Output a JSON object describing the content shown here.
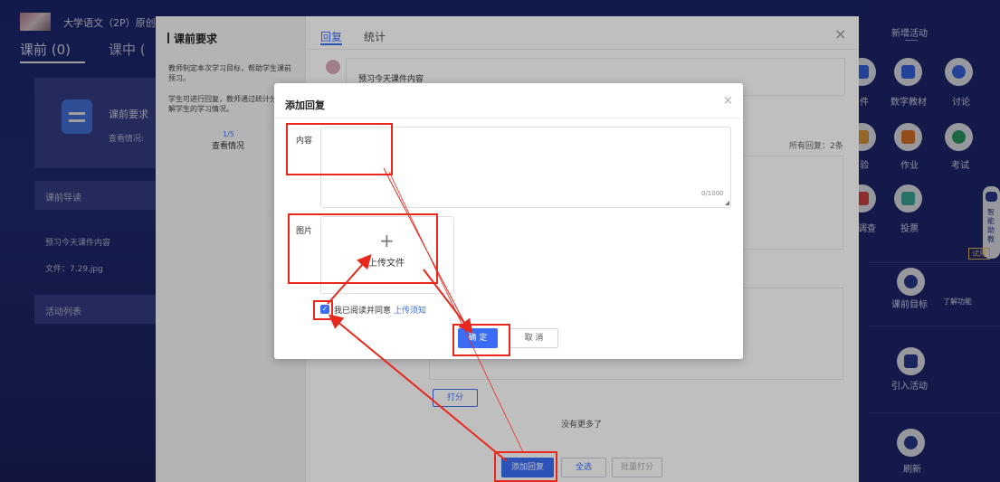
{
  "course": {
    "title": "大学语文（2P）原创",
    "tabs": [
      "课前 (0)",
      "课中 ("
    ],
    "card_title": "课前要求",
    "card_sub": "查看情况:",
    "section_guide": "课前导读",
    "guide_item": "预习今天课件内容",
    "file_label": "文件：7.29.jpg",
    "section_list": "活动列表"
  },
  "right_panel": {
    "new_activity": "新增活动",
    "items": [
      {
        "label": "件",
        "icon": "courseware-icon"
      },
      {
        "label": "数字教材",
        "icon": "digital-textbook-icon"
      },
      {
        "label": "讨论",
        "icon": "discussion-icon"
      },
      {
        "label": "验",
        "icon": "experiment-icon"
      },
      {
        "label": "作业",
        "icon": "homework-icon"
      },
      {
        "label": "考试",
        "icon": "exam-icon"
      },
      {
        "label": "调查",
        "icon": "survey-icon"
      },
      {
        "label": "投票",
        "icon": "vote-icon"
      }
    ],
    "goal_label": "课前目标",
    "understand": "了解功能",
    "import_label": "引入活动",
    "refresh_label": "刷新",
    "assistant": "智能助教",
    "trial": "试用"
  },
  "panel": {
    "left_title": "课前要求",
    "left_desc1": "教师制定本次学习目标，帮助学生课前预习。",
    "left_desc2": "学生可进行回复，教师通过统计分析了解学生的学习情况。",
    "fraction": "1/5",
    "view_status": "查看情况",
    "tab_reply": "回复",
    "tab_stats": "统计",
    "close": "×",
    "task_text": "预习今天课件内容",
    "all_replies": "所有回复：2条",
    "score_btn": "打分",
    "no_more": "没有更多了",
    "add_reply_btn": "添加回复",
    "select_all_btn": "全选",
    "batch_score_btn": "批量打分"
  },
  "modal": {
    "title": "添加回复",
    "close": "×",
    "content_label": "内容",
    "counter": "0/1000",
    "image_label": "图片",
    "upload_plus": "+",
    "upload_text": "上传文件",
    "agree_text": "我已阅读并同意",
    "agree_link": "上传须知",
    "agree_checked": true,
    "confirm": "确 定",
    "cancel": "取 消"
  },
  "colors": {
    "accent": "#3b6cf5",
    "annotation": "#e8281c",
    "bg": "#1e2a7a"
  }
}
